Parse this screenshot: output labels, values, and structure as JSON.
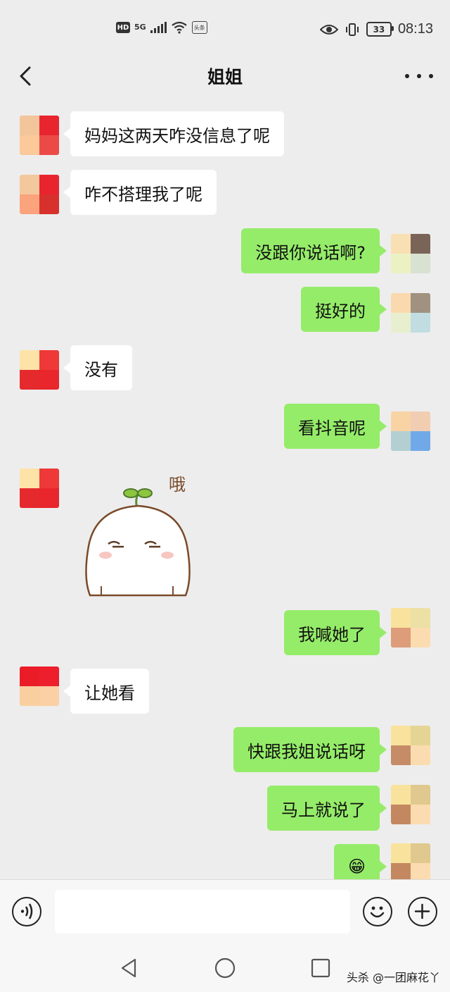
{
  "status_bar": {
    "hd_label": "HD",
    "network_label": "5G",
    "app_label": "头条",
    "battery_level": "33",
    "time": "08:13"
  },
  "header": {
    "title": "姐姐",
    "back_icon": "chevron-left-icon",
    "more_icon": "more-dots-icon"
  },
  "colors": {
    "background": "#ededed",
    "incoming_bubble": "#ffffff",
    "outgoing_bubble": "#95ec69"
  },
  "messages": [
    {
      "side": "in",
      "text": "妈妈这两天咋没信息了呢"
    },
    {
      "side": "in",
      "text": "咋不搭理我了呢"
    },
    {
      "side": "out",
      "text": "没跟你说话啊?"
    },
    {
      "side": "out",
      "text": "挺好的"
    },
    {
      "side": "in",
      "text": "没有"
    },
    {
      "side": "out",
      "text": "看抖音呢"
    },
    {
      "side": "in",
      "type": "sticker",
      "text": "哦"
    },
    {
      "side": "out",
      "text": "我喊她了"
    },
    {
      "side": "in",
      "text": "让她看"
    },
    {
      "side": "out",
      "text": "快跟我姐说话呀"
    },
    {
      "side": "out",
      "text": "马上就说了"
    },
    {
      "side": "out",
      "type": "emoji",
      "text": "😁"
    }
  ],
  "input_bar": {
    "voice_icon": "voice-icon",
    "emoji_icon": "smiley-icon",
    "plus_icon": "plus-icon",
    "input_value": ""
  },
  "nav_bar": {
    "back_icon": "triangle-back-icon",
    "home_icon": "circle-home-icon",
    "recents_icon": "square-recents-icon",
    "watermark": "头杀 @一团麻花丫"
  }
}
